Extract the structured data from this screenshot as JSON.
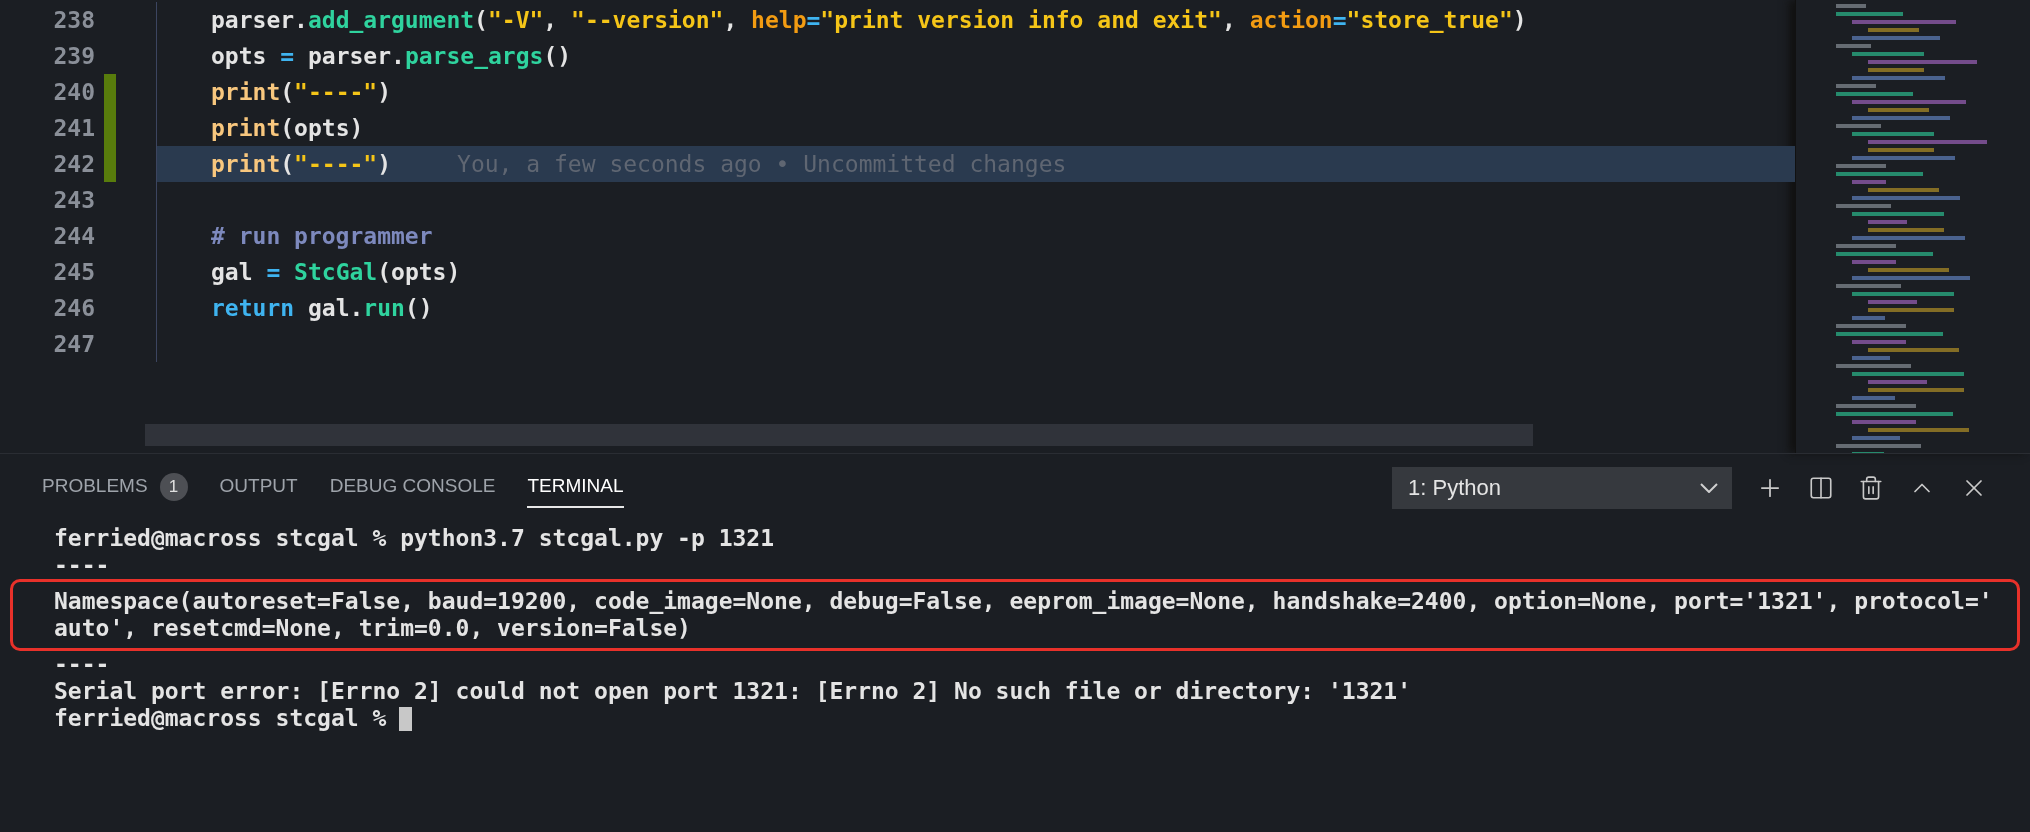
{
  "editor": {
    "lines": [
      {
        "number": "238",
        "changed": false,
        "current": false,
        "tokens": [
          {
            "text": "parser.",
            "kind": "plain"
          },
          {
            "text": "add_argument",
            "kind": "func"
          },
          {
            "text": "(",
            "kind": "plain"
          },
          {
            "text": "\"-V\"",
            "kind": "string"
          },
          {
            "text": ", ",
            "kind": "plain"
          },
          {
            "text": "\"--version\"",
            "kind": "string"
          },
          {
            "text": ", ",
            "kind": "plain"
          },
          {
            "text": "help",
            "kind": "param"
          },
          {
            "text": "=",
            "kind": "op"
          },
          {
            "text": "\"print version info and exit\"",
            "kind": "string"
          },
          {
            "text": ", ",
            "kind": "plain"
          },
          {
            "text": "action",
            "kind": "param"
          },
          {
            "text": "=",
            "kind": "op"
          },
          {
            "text": "\"store_true\"",
            "kind": "string"
          },
          {
            "text": ")",
            "kind": "plain"
          }
        ]
      },
      {
        "number": "239",
        "changed": false,
        "current": false,
        "tokens": [
          {
            "text": "opts ",
            "kind": "plain"
          },
          {
            "text": "=",
            "kind": "op"
          },
          {
            "text": " parser.",
            "kind": "plain"
          },
          {
            "text": "parse_args",
            "kind": "func"
          },
          {
            "text": "()",
            "kind": "plain"
          }
        ]
      },
      {
        "number": "240",
        "changed": true,
        "current": false,
        "tokens": [
          {
            "text": "print",
            "kind": "builtin"
          },
          {
            "text": "(",
            "kind": "plain"
          },
          {
            "text": "\"----\"",
            "kind": "string"
          },
          {
            "text": ")",
            "kind": "plain"
          }
        ]
      },
      {
        "number": "241",
        "changed": true,
        "current": false,
        "tokens": [
          {
            "text": "print",
            "kind": "builtin"
          },
          {
            "text": "(opts)",
            "kind": "plain"
          }
        ]
      },
      {
        "number": "242",
        "changed": true,
        "current": true,
        "annotation": "You, a few seconds ago • Uncommitted changes",
        "tokens": [
          {
            "text": "print",
            "kind": "builtin"
          },
          {
            "text": "(",
            "kind": "plain"
          },
          {
            "text": "\"----\"",
            "kind": "string"
          },
          {
            "text": ")",
            "kind": "plain"
          }
        ]
      },
      {
        "number": "243",
        "changed": false,
        "current": false
      },
      {
        "number": "244",
        "changed": false,
        "current": false,
        "tokens": [
          {
            "text": "# run programmer",
            "kind": "comment"
          }
        ]
      },
      {
        "number": "245",
        "changed": false,
        "current": false,
        "tokens": [
          {
            "text": "gal ",
            "kind": "plain"
          },
          {
            "text": "= ",
            "kind": "op"
          },
          {
            "text": "StcGal",
            "kind": "class"
          },
          {
            "text": "(opts)",
            "kind": "plain"
          }
        ]
      },
      {
        "number": "246",
        "changed": false,
        "current": false,
        "tokens": [
          {
            "text": "return",
            "kind": "keyword"
          },
          {
            "text": " gal.",
            "kind": "plain"
          },
          {
            "text": "run",
            "kind": "func"
          },
          {
            "text": "()",
            "kind": "plain"
          }
        ]
      },
      {
        "number": "247",
        "changed": false,
        "current": false
      }
    ]
  },
  "panel": {
    "tabs": [
      {
        "label": "PROBLEMS",
        "badge": "1",
        "selected": false
      },
      {
        "label": "OUTPUT",
        "selected": false
      },
      {
        "label": "DEBUG CONSOLE",
        "selected": false
      },
      {
        "label": "TERMINAL",
        "selected": true
      }
    ],
    "terminal_select": {
      "value": "1: Python"
    }
  },
  "terminal": {
    "lines": [
      {
        "text": "ferried@macross stcgal % python3.7 stcgal.py -p 1321",
        "boxed": false,
        "cursor": false
      },
      {
        "text": "----",
        "boxed": false,
        "cursor": false
      },
      {
        "text": "Namespace(autoreset=False, baud=19200, code_image=None, debug=False, eeprom_image=None, handshake=2400, option=None, port='1321', protocol='",
        "boxed": true,
        "cursor": false
      },
      {
        "text": "auto', resetcmd=None, trim=0.0, version=False)",
        "boxed": true,
        "cursor": false
      },
      {
        "text": "----",
        "boxed": false,
        "cursor": false
      },
      {
        "text": "Serial port error: [Errno 2] could not open port 1321: [Errno 2] No such file or directory: '1321'",
        "boxed": false,
        "cursor": false
      },
      {
        "text": "ferried@macross stcgal %",
        "boxed": false,
        "cursor": true
      }
    ]
  }
}
